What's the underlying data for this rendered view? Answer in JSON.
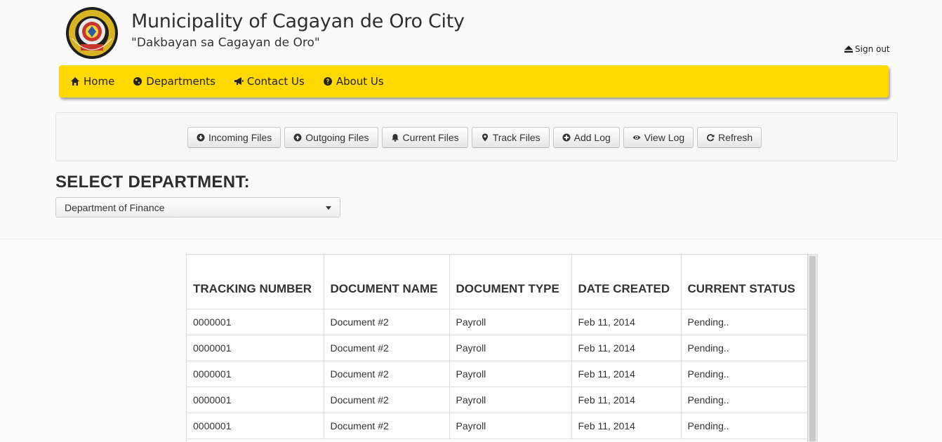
{
  "header": {
    "title": "Municipality of Cagayan de Oro City",
    "motto": "\"Dakbayan sa Cagayan de Oro\"",
    "seal_icon": "city-seal",
    "signout_label": "Sign out"
  },
  "nav": {
    "bg_color": "#ffd900",
    "items": [
      {
        "label": "Home",
        "icon": "home-icon"
      },
      {
        "label": "Departments",
        "icon": "globe-icon"
      },
      {
        "label": "Contact Us",
        "icon": "bullhorn-icon"
      },
      {
        "label": "About Us",
        "icon": "question-icon"
      }
    ]
  },
  "actions": {
    "buttons": [
      {
        "label": "Incoming Files",
        "icon": "arrow-circle-down-icon"
      },
      {
        "label": "Outgoing Files",
        "icon": "arrow-circle-up-icon"
      },
      {
        "label": "Current Files",
        "icon": "bell-icon"
      },
      {
        "label": "Track Files",
        "icon": "map-marker-icon"
      },
      {
        "label": "Add Log",
        "icon": "plus-circle-icon"
      },
      {
        "label": "View Log",
        "icon": "eye-icon"
      },
      {
        "label": "Refresh",
        "icon": "refresh-icon"
      }
    ]
  },
  "department": {
    "label": "SELECT DEPARTMENT:",
    "selected": "Department of Finance"
  },
  "table": {
    "columns": [
      "TRACKING NUMBER",
      "DOCUMENT NAME",
      "DOCUMENT TYPE",
      "DATE CREATED",
      "CURRENT STATUS"
    ],
    "rows": [
      [
        "0000001",
        "Document #2",
        "Payroll",
        "Feb 11, 2014",
        "Pending.."
      ],
      [
        "0000001",
        "Document #2",
        "Payroll",
        "Feb 11, 2014",
        "Pending.."
      ],
      [
        "0000001",
        "Document #2",
        "Payroll",
        "Feb 11, 2014",
        "Pending.."
      ],
      [
        "0000001",
        "Document #2",
        "Payroll",
        "Feb 11, 2014",
        "Pending.."
      ],
      [
        "0000001",
        "Document #2",
        "Payroll",
        "Feb 11, 2014",
        "Pending.."
      ]
    ]
  }
}
